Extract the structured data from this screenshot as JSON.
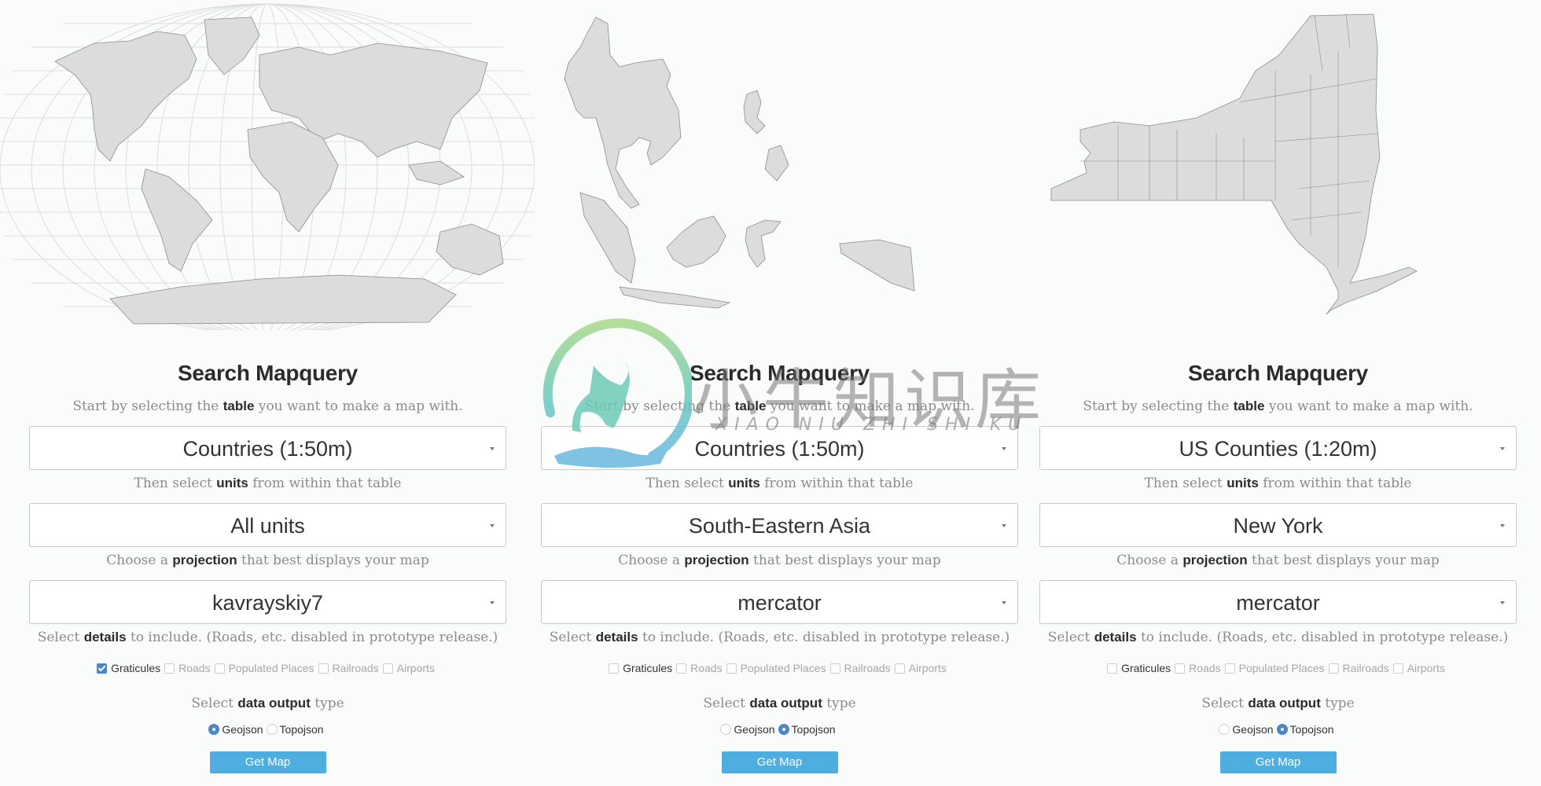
{
  "panels": [
    {
      "map_name": "world",
      "title": "Search Mapquery",
      "table_hint": {
        "pre": "Start by selecting the ",
        "bold": "table",
        "post": " you want to make a map with."
      },
      "table_value": "Countries (1:50m)",
      "units_hint": {
        "pre": "Then select ",
        "bold": "units",
        "post": " from within that table"
      },
      "units_value": "All units",
      "projection_hint": {
        "pre": "Choose a ",
        "bold": "projection",
        "post": " that best displays your map"
      },
      "projection_value": "kavrayskiy7",
      "details_hint": {
        "pre": "Select ",
        "bold": "details",
        "post": " to include. (Roads, etc. disabled in prototype release.)"
      },
      "details": [
        {
          "label": "Graticules",
          "checked": true,
          "enabled": true
        },
        {
          "label": "Roads",
          "checked": false,
          "enabled": false
        },
        {
          "label": "Populated Places",
          "checked": false,
          "enabled": false
        },
        {
          "label": "Railroads",
          "checked": false,
          "enabled": false
        },
        {
          "label": "Airports",
          "checked": false,
          "enabled": false
        }
      ],
      "output_hint": {
        "pre": "Select ",
        "bold": "data output",
        "post": " type"
      },
      "outputs": [
        {
          "label": "Geojson",
          "selected": true
        },
        {
          "label": "Topojson",
          "selected": false
        }
      ],
      "button": "Get Map"
    },
    {
      "map_name": "south-eastern-asia",
      "title": "Search Mapquery",
      "table_hint": {
        "pre": "Start by selecting the ",
        "bold": "table",
        "post": " you want to make a map with."
      },
      "table_value": "Countries (1:50m)",
      "units_hint": {
        "pre": "Then select ",
        "bold": "units",
        "post": " from within that table"
      },
      "units_value": "South-Eastern Asia",
      "projection_hint": {
        "pre": "Choose a ",
        "bold": "projection",
        "post": " that best displays your map"
      },
      "projection_value": "mercator",
      "details_hint": {
        "pre": "Select ",
        "bold": "details",
        "post": " to include. (Roads, etc. disabled in prototype release.)"
      },
      "details": [
        {
          "label": "Graticules",
          "checked": false,
          "enabled": true
        },
        {
          "label": "Roads",
          "checked": false,
          "enabled": false
        },
        {
          "label": "Populated Places",
          "checked": false,
          "enabled": false
        },
        {
          "label": "Railroads",
          "checked": false,
          "enabled": false
        },
        {
          "label": "Airports",
          "checked": false,
          "enabled": false
        }
      ],
      "output_hint": {
        "pre": "Select ",
        "bold": "data output",
        "post": " type"
      },
      "outputs": [
        {
          "label": "Geojson",
          "selected": false
        },
        {
          "label": "Topojson",
          "selected": true
        }
      ],
      "button": "Get Map"
    },
    {
      "map_name": "new-york-counties",
      "title": "Search Mapquery",
      "table_hint": {
        "pre": "Start by selecting the ",
        "bold": "table",
        "post": " you want to make a map with."
      },
      "table_value": "US Counties (1:20m)",
      "units_hint": {
        "pre": "Then select ",
        "bold": "units",
        "post": " from within that table"
      },
      "units_value": "New York",
      "projection_hint": {
        "pre": "Choose a ",
        "bold": "projection",
        "post": " that best displays your map"
      },
      "projection_value": "mercator",
      "details_hint": {
        "pre": "Select ",
        "bold": "details",
        "post": " to include. (Roads, etc. disabled in prototype release.)"
      },
      "details": [
        {
          "label": "Graticules",
          "checked": false,
          "enabled": true
        },
        {
          "label": "Roads",
          "checked": false,
          "enabled": false
        },
        {
          "label": "Populated Places",
          "checked": false,
          "enabled": false
        },
        {
          "label": "Railroads",
          "checked": false,
          "enabled": false
        },
        {
          "label": "Airports",
          "checked": false,
          "enabled": false
        }
      ],
      "output_hint": {
        "pre": "Select ",
        "bold": "data output",
        "post": " type"
      },
      "outputs": [
        {
          "label": "Geojson",
          "selected": false
        },
        {
          "label": "Topojson",
          "selected": true
        }
      ],
      "button": "Get Map"
    }
  ],
  "watermark": {
    "text": "小牛知识库",
    "subtext": "XIAO NIU ZHI SHI KU"
  },
  "colors": {
    "accent": "#4a86c8",
    "button": "#4eaee0",
    "land": "#dcdcdc",
    "border": "#8c8c8c"
  }
}
